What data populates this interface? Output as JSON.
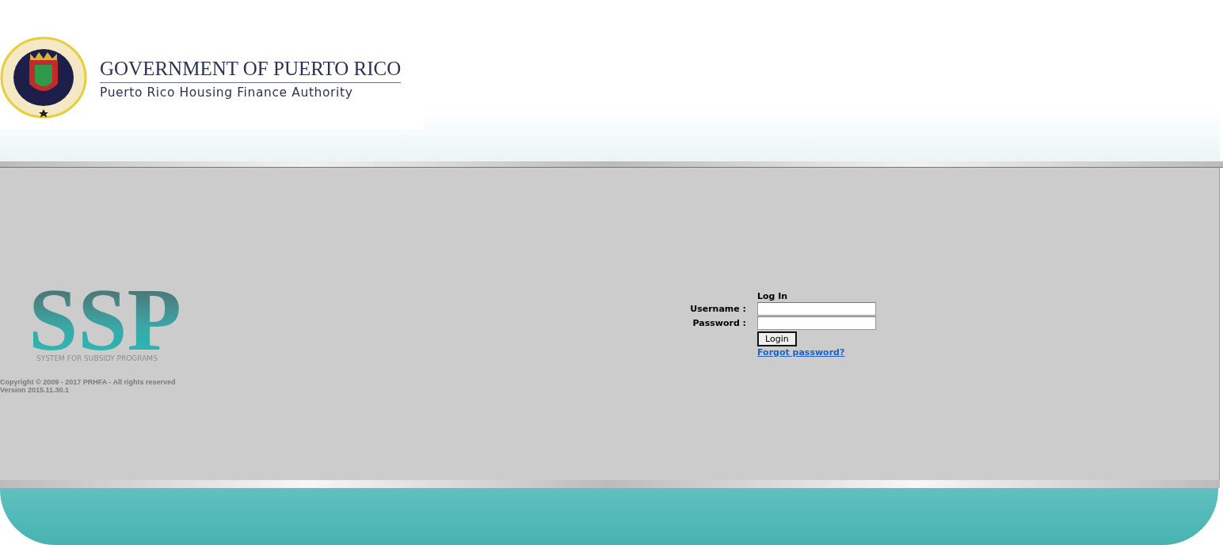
{
  "header": {
    "title": "GOVERNMENT OF PUERTO RICO",
    "subtitle": "Puerto Rico Housing Finance Authority"
  },
  "brand": {
    "logo": "SSP",
    "tagline": "SYSTEM FOR SUBSIDY PROGRAMS",
    "copyright": "Copyright © 2009 - 2017 PRHFA - All rights reserved",
    "version": "Version 2015.11.30.1"
  },
  "login": {
    "heading": "Log In",
    "fields": [
      {
        "label": "Username :"
      },
      {
        "label": "Password :"
      }
    ],
    "button": "Login",
    "link": "Forgot password?"
  }
}
